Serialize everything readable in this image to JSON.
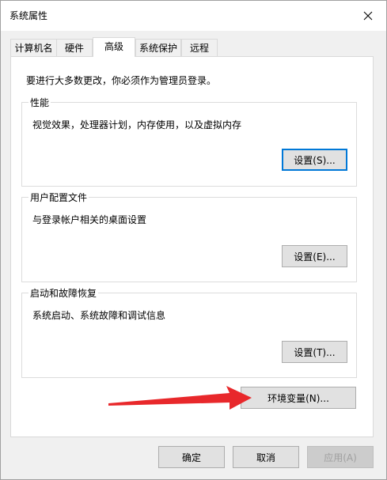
{
  "window": {
    "title": "系统属性"
  },
  "tabs": [
    {
      "label": "计算机名"
    },
    {
      "label": "硬件"
    },
    {
      "label": "高级"
    },
    {
      "label": "系统保护"
    },
    {
      "label": "远程"
    }
  ],
  "advanced": {
    "admin_note": "要进行大多数更改，你必须作为管理员登录。",
    "performance": {
      "title": "性能",
      "description": "视觉效果，处理器计划，内存使用，以及虚拟内存",
      "button": "设置(S)..."
    },
    "user_profiles": {
      "title": "用户配置文件",
      "description": "与登录帐户相关的桌面设置",
      "button": "设置(E)..."
    },
    "startup_recovery": {
      "title": "启动和故障恢复",
      "description": "系统启动、系统故障和调试信息",
      "button": "设置(T)..."
    },
    "env_vars_button": "环境变量(N)..."
  },
  "footer": {
    "ok": "确定",
    "cancel": "取消",
    "apply": "应用(A)"
  },
  "colors": {
    "arrow": "#e8282b",
    "focus_border": "#0078d7"
  }
}
